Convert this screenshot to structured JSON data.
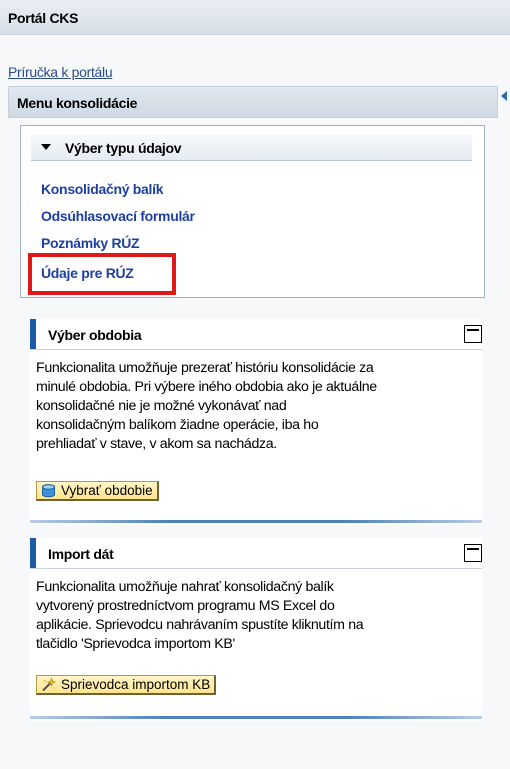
{
  "header": {
    "title": "Portál CKS"
  },
  "help_link": "Príručka k portálu",
  "menu": {
    "title": "Menu konsolidácie",
    "data_type_panel": {
      "title": "Výber typu údajov",
      "links": [
        {
          "label": "Konsolidačný balík"
        },
        {
          "label": "Odsúhlasovací formulár"
        },
        {
          "label": "Poznámky RÚZ"
        },
        {
          "label": "Údaje pre RÚZ",
          "highlighted": true
        }
      ]
    }
  },
  "period_section": {
    "title": "Výber obdobia",
    "lines": [
      "Funkcionalita umožňuje prezerať históriu konsolidácie za",
      "minulé obdobia. Pri výbere iného obdobia ako je aktuálne",
      "konsolidačné nie je možné vykonávať nad",
      "konsolidačným balíkom žiadne operácie, iba ho",
      "prehliadať v stave, v akom sa nachádza."
    ],
    "button_label": "Vybrať obdobie",
    "button_icon": "database-icon"
  },
  "import_section": {
    "title": "Import dát",
    "lines": [
      "Funkcionalita umožňuje nahrať konsolidačný balík",
      "vytvorený prostredníctvom programu MS Excel do",
      "aplikácie. Sprievodcu nahrávaním spustíte kliknutím na",
      "tlačidlo 'Sprievodca importom KB'"
    ],
    "button_label": "Sprievodca importom KB",
    "button_icon": "magic-wand-icon"
  },
  "colors": {
    "link": "#1d3fa0",
    "highlight_border": "#e01818",
    "section_accent": "#1d5aa8",
    "button_bg": "#ffe58e"
  }
}
